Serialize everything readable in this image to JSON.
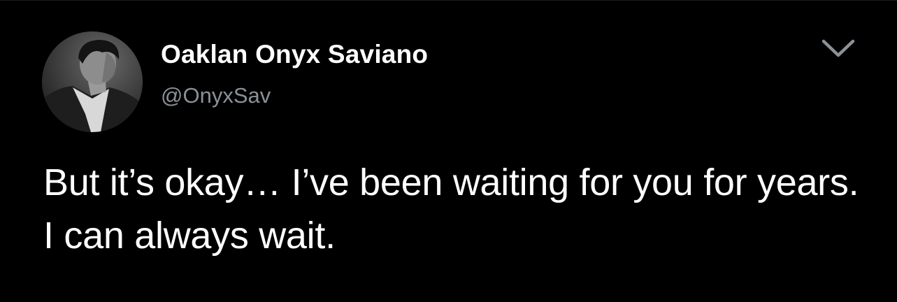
{
  "author": {
    "display_name": "Oaklan Onyx Saviano",
    "handle": "@OnyxSav"
  },
  "tweet": {
    "text": "But it’s okay… I’ve been waiting for you for years. I can always wait."
  },
  "icons": {
    "menu": "chevron-down-icon",
    "avatar": "avatar-photo"
  },
  "colors": {
    "background": "#000000",
    "primary_text": "#ffffff",
    "secondary_text": "#8b9196",
    "icon": "#8b9196"
  }
}
